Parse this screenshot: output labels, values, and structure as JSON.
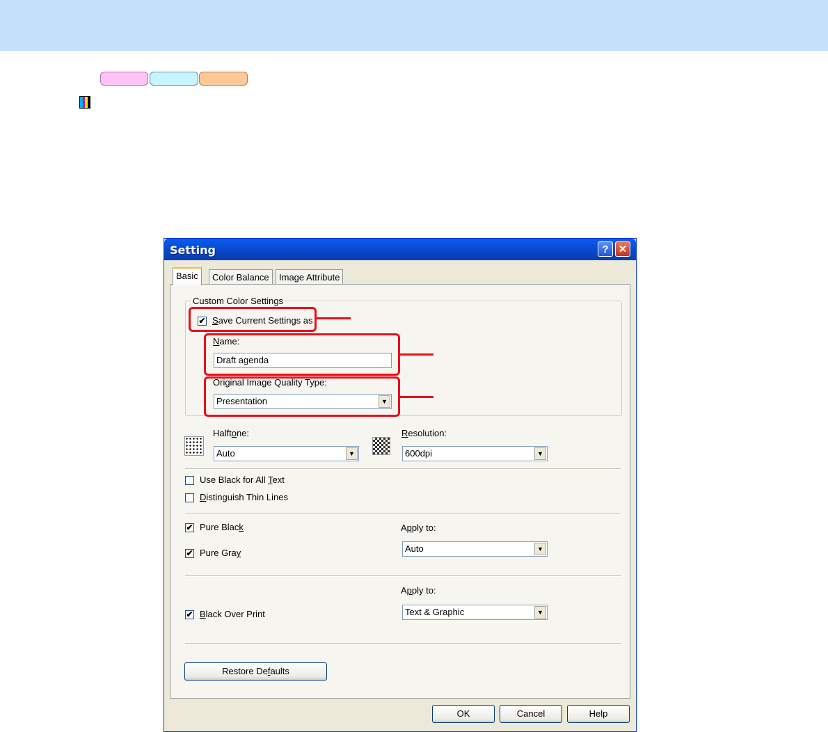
{
  "colors": {
    "header_band": "#c4e0fb",
    "pill_1": "#ffc4f5",
    "pill_2": "#c8f4ff",
    "pill_3": "#ffc898",
    "callout": "#e8101a",
    "titlebar": "#0847c8"
  },
  "dialog": {
    "title": "Setting",
    "help_label": "?",
    "close_label": "✕",
    "tabs": [
      "Basic",
      "Color Balance",
      "Image Attribute"
    ],
    "custom_color_settings": {
      "legend": "Custom Color Settings",
      "save_checkbox": {
        "label_access": "S",
        "label_rest": "ave Current Settings as",
        "checked": true
      },
      "name_label_access": "N",
      "name_label_rest": "ame:",
      "name_value": "Draft agenda",
      "quality_label": "Original Image Quality Type:",
      "quality_value": "Presentation"
    },
    "halftone": {
      "label_a": "Halft",
      "label_access": "o",
      "label_b": "ne:",
      "value": "Auto",
      "icon": "halftone-icon"
    },
    "resolution": {
      "label_access": "R",
      "label_rest": "esolution:",
      "value": "600dpi",
      "icon": "resolution-icon"
    },
    "use_black_text": {
      "label_a": "Use Black for All ",
      "label_access": "T",
      "label_b": "ext",
      "checked": false
    },
    "distinguish_thin": {
      "label_access": "D",
      "label_rest": "istinguish Thin Lines",
      "checked": false
    },
    "pure_black": {
      "label_a": "Pure Blac",
      "label_access": "k",
      "checked": true
    },
    "pure_gray": {
      "label_a": "Pure Gra",
      "label_access": "y",
      "checked": true
    },
    "apply_to_1": {
      "label_a": "A",
      "label_access": "p",
      "label_b": "ply to:",
      "value": "Auto"
    },
    "black_over_print": {
      "label_access": "B",
      "label_rest": "lack Over Print",
      "checked": true
    },
    "apply_to_2": {
      "label_a": "A",
      "label_access": "p",
      "label_b": "ply to:",
      "value": "Text & Graphic"
    },
    "restore_defaults": {
      "label_a": "Restore De",
      "label_access": "f",
      "label_b": "aults"
    },
    "ok_label": "OK",
    "cancel_label": "Cancel",
    "help_button_label": "Help",
    "check_mark": "✔",
    "dropdown_arrow": "▼"
  }
}
